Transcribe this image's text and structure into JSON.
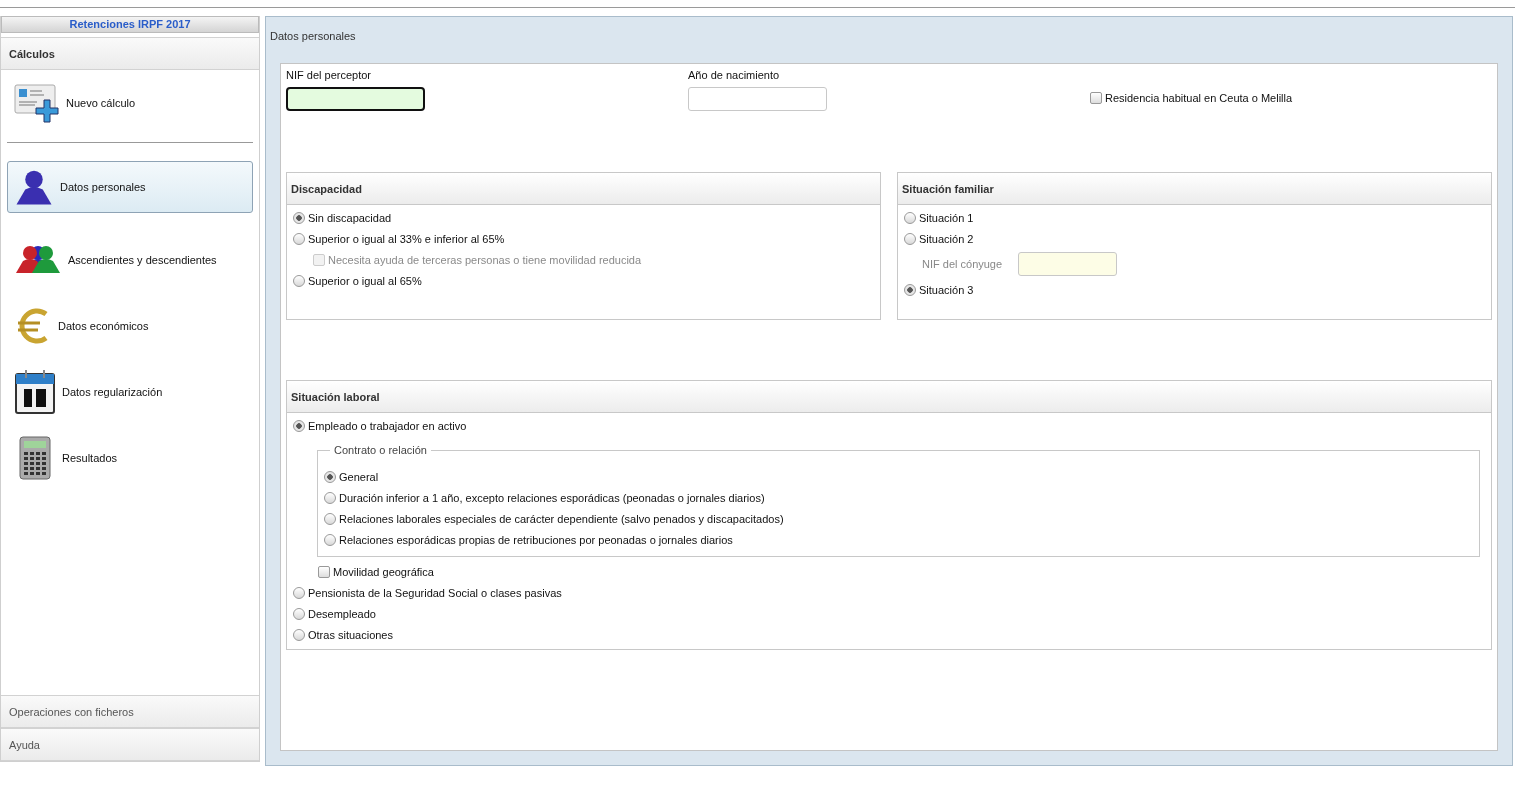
{
  "sidebar": {
    "title": "Retenciones IRPF 2017",
    "sections": [
      {
        "label": "Cálculos",
        "expanded": true
      },
      {
        "label": "Operaciones con ficheros",
        "expanded": false
      },
      {
        "label": "Ayuda",
        "expanded": false
      }
    ],
    "actions": [
      {
        "label": "Nuevo cálculo"
      }
    ],
    "steps": [
      {
        "label": "Datos personales",
        "selected": true
      },
      {
        "label": "Ascendientes y descendientes",
        "selected": false
      },
      {
        "label": "Datos económicos",
        "selected": false
      },
      {
        "label": "Datos regularización",
        "selected": false
      },
      {
        "label": "Resultados",
        "selected": false
      }
    ]
  },
  "panel": {
    "title": "Datos personales",
    "nif": {
      "label": "NIF del perceptor",
      "focused": true
    },
    "birth_year": {
      "label": "Año de nacimiento",
      "focused": false
    },
    "residence": {
      "label": "Residencia habitual en Ceuta o Melilla",
      "checked": false
    },
    "disability": {
      "title": "Discapacidad",
      "options": [
        {
          "kind": "radio",
          "label": "Sin discapacidad",
          "selected": true
        },
        {
          "kind": "radio",
          "label": "Superior o igual al 33% e inferior al 65%",
          "selected": false
        },
        {
          "kind": "checkbox",
          "label": "Necesita ayuda de terceras personas o tiene movilidad reducida",
          "checked": false,
          "disabled": true
        },
        {
          "kind": "radio",
          "label": "Superior o igual al 65%",
          "selected": false
        }
      ]
    },
    "family": {
      "title": "Situación familiar",
      "options": [
        {
          "kind": "radio",
          "label": "Situación 1",
          "selected": false
        },
        {
          "kind": "radio",
          "label": "Situación 2",
          "selected": false
        },
        {
          "kind": "field",
          "label": "NIF del cónyuge",
          "disabled": true
        },
        {
          "kind": "radio",
          "label": "Situación 3",
          "selected": true
        }
      ]
    },
    "work": {
      "title": "Situación laboral",
      "options": [
        {
          "label": "Empleado o trabajador en activo",
          "selected": true,
          "contract": {
            "legend": "Contrato o relación",
            "options": [
              {
                "label": "General",
                "selected": true
              },
              {
                "label": "Duración inferior a 1 año, excepto relaciones esporádicas (peonadas o jornales diarios)",
                "selected": false
              },
              {
                "label": "Relaciones laborales especiales de carácter dependiente (salvo penados y discapacitados)",
                "selected": false
              },
              {
                "label": "Relaciones esporádicas propias de retribuciones por peonadas o jornales diarios",
                "selected": false
              }
            ]
          },
          "mobility": {
            "label": "Movilidad geográfica",
            "checked": false
          }
        },
        {
          "label": "Pensionista de la Seguridad Social o clases pasivas",
          "selected": false
        },
        {
          "label": "Desempleado",
          "selected": false
        },
        {
          "label": "Otras situaciones",
          "selected": false
        }
      ]
    }
  }
}
